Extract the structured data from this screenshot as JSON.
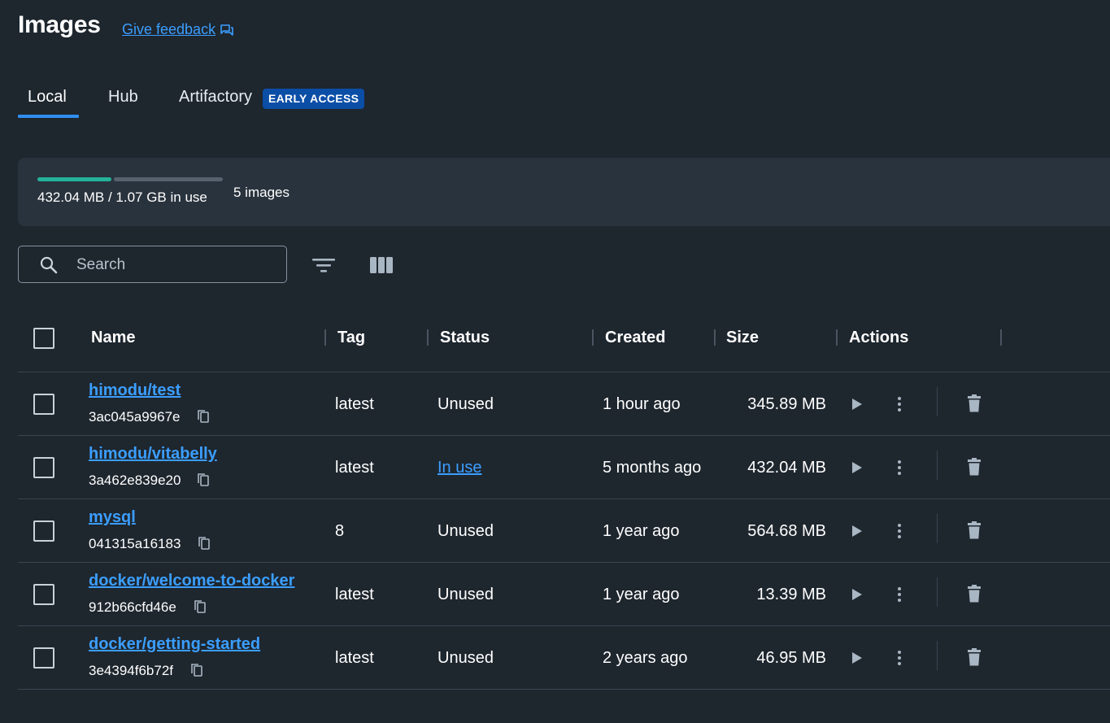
{
  "header": {
    "title": "Images",
    "feedback_label": "Give feedback"
  },
  "tabs": [
    {
      "label": "Local",
      "active": true
    },
    {
      "label": "Hub",
      "active": false
    },
    {
      "label": "Artifactory",
      "active": false,
      "badge": "EARLY ACCESS"
    }
  ],
  "usage": {
    "text": "432.04 MB / 1.07 GB in use",
    "fraction_used": 0.4,
    "count_text": "5 images"
  },
  "search": {
    "placeholder": "Search",
    "value": ""
  },
  "table": {
    "columns": [
      "Name",
      "Tag",
      "Status",
      "Created",
      "Size",
      "Actions"
    ],
    "rows": [
      {
        "name": "himodu/test",
        "id": "3ac045a9967e",
        "tag": "latest",
        "status": "Unused",
        "in_use": false,
        "created": "1 hour ago",
        "size": "345.89 MB"
      },
      {
        "name": "himodu/vitabelly",
        "id": "3a462e839e20",
        "tag": "latest",
        "status": "In use",
        "in_use": true,
        "created": "5 months ago",
        "size": "432.04 MB"
      },
      {
        "name": "mysql",
        "id": "041315a16183",
        "tag": "8",
        "status": "Unused",
        "in_use": false,
        "created": "1 year ago",
        "size": "564.68 MB"
      },
      {
        "name": "docker/welcome-to-docker",
        "id": "912b66cfd46e",
        "tag": "latest",
        "status": "Unused",
        "in_use": false,
        "created": "1 year ago",
        "size": "13.39 MB"
      },
      {
        "name": "docker/getting-started",
        "id": "3e4394f6b72f",
        "tag": "latest",
        "status": "Unused",
        "in_use": false,
        "created": "2 years ago",
        "size": "46.95 MB"
      }
    ]
  },
  "icons": {
    "feedback": "feedback-icon",
    "search": "search-icon",
    "filter": "filter-icon",
    "columns": "columns-icon",
    "copy": "copy-icon",
    "run": "play-icon",
    "more": "more-vertical-icon",
    "delete": "trash-icon"
  },
  "colors": {
    "accent": "#3b9eff",
    "tab_indicator": "#2f8ef0",
    "usage_bar": "#24b29a",
    "badge_bg": "#0b4ea6",
    "background": "#1e262e"
  }
}
